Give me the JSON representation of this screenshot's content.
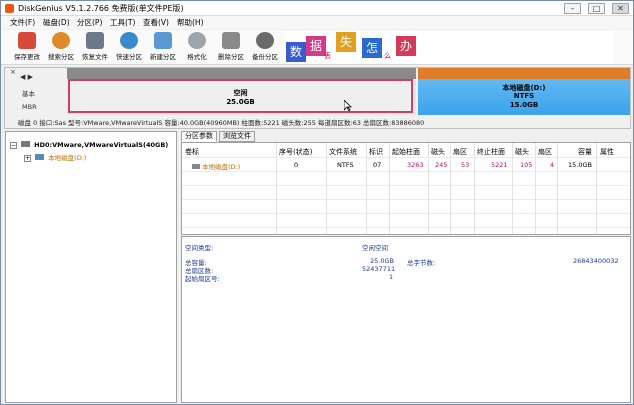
{
  "window": {
    "title": "DiskGenius V5.1.2.766 免费版(单文件PE版)"
  },
  "menu": [
    "文件(F)",
    "磁盘(D)",
    "分区(P)",
    "工具(T)",
    "查看(V)",
    "帮助(H)"
  ],
  "toolbar": [
    {
      "label": "保存更改",
      "icon": "save-icon",
      "color": "#d64a3a"
    },
    {
      "label": "搜索分区",
      "icon": "search-icon",
      "color": "#e08a2a"
    },
    {
      "label": "恢复文件",
      "icon": "restore-icon",
      "color": "#6a7a8a"
    },
    {
      "label": "快速分区",
      "icon": "quick-partition-icon",
      "color": "#3a8ad0"
    },
    {
      "label": "新建分区",
      "icon": "new-partition-icon",
      "color": "#5a9ad0"
    },
    {
      "label": "格式化",
      "icon": "format-icon",
      "color": "#9aa5ad"
    },
    {
      "label": "删除分区",
      "icon": "delete-icon",
      "color": "#8a8a8a"
    },
    {
      "label": "备份分区",
      "icon": "backup-icon",
      "color": "#6a6a6a"
    }
  ],
  "banner": {
    "chars": [
      "数",
      "据",
      "失",
      "怎",
      "办"
    ],
    "small": [
      "丢",
      "么"
    ]
  },
  "diskmap": {
    "nav": "◀ ▶",
    "basic_label": "基本",
    "mbr_label": "MBR",
    "free": {
      "label": "空闲",
      "size": "25.0GB"
    },
    "ntfs": {
      "label": "本地磁盘(D:)",
      "fs": "NTFS",
      "size": "15.0GB"
    }
  },
  "disk_info": "磁盘 0 接口:Sas  型号:VMware,VMwareVirtualS  容量:40.0GB(40960MB)  柱面数:5221  磁头数:255  每道扇区数:63  总扇区数:83886080",
  "tree": {
    "disk": "HD0:VMware,VMwareVirtualS(40GB)",
    "partition": "本地磁盘(D:)"
  },
  "tabs": [
    "分区参数",
    "浏览文件"
  ],
  "table": {
    "headers": [
      "卷标",
      "序号(状态)",
      "文件系统",
      "标识",
      "起始柱面",
      "磁头",
      "扇区",
      "终止柱面",
      "磁头",
      "扇区",
      "容量",
      "属性"
    ],
    "rows": [
      [
        "本地磁盘(D:)",
        "0",
        "NTFS",
        "07",
        "3263",
        "245",
        "53",
        "5221",
        "105",
        "4",
        "15.0GB",
        ""
      ]
    ]
  },
  "details": {
    "type_label": "空间类型:",
    "type_value": "空闲空间",
    "capacity_label": "总容量:",
    "capacity_value": "25.0GB",
    "total_bytes_label": "总字节数:",
    "total_bytes_value": "26843400032",
    "sectors_label": "总扇区数:",
    "sectors_value": "52437711",
    "start_sector_label": "起始扇区号:",
    "start_sector_value": "1"
  }
}
